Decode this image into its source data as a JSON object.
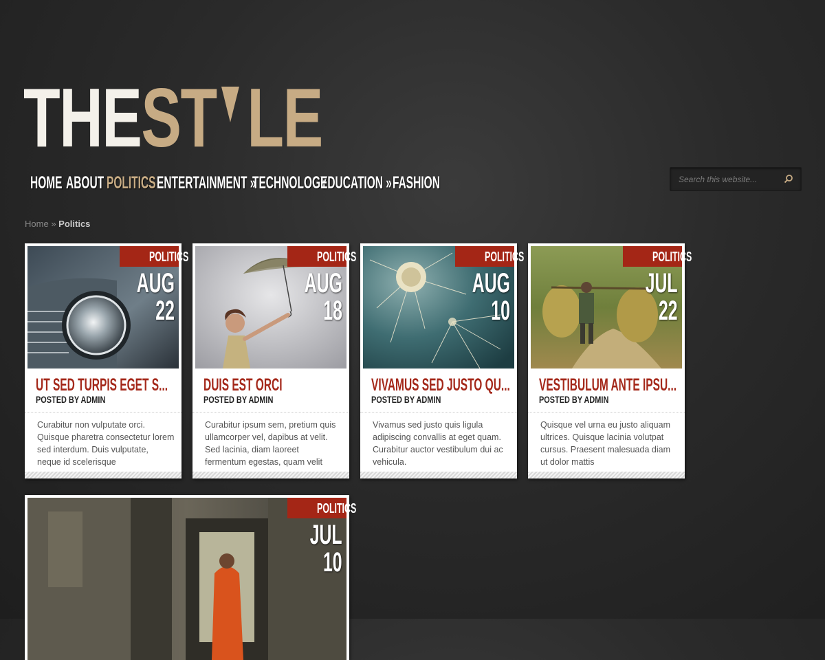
{
  "logo": {
    "part1": "THE",
    "part2": "ST",
    "part3": "LE"
  },
  "nav": {
    "items": [
      "HOME",
      "ABOUT",
      "POLITICS",
      "ENTERTAINMENT »",
      "TECHNOLOGY",
      "EDUCATION »",
      "FASHION"
    ],
    "active_index": 2
  },
  "search": {
    "placeholder": "Search this website..."
  },
  "breadcrumb": {
    "home": "Home",
    "sep": "»",
    "current": "Politics"
  },
  "posts": [
    {
      "category": "POLITICS",
      "month": "AUG",
      "day": "22",
      "title": "UT SED TURPIS EGET S...",
      "author": "POSTED BY ADMIN",
      "excerpt": "Curabitur non vulputate orci. Quisque pharetra consectetur lorem sed interdum. Duis vulputate, neque id scelerisque"
    },
    {
      "category": "POLITICS",
      "month": "AUG",
      "day": "18",
      "title": "DUIS EST ORCI",
      "author": "POSTED BY ADMIN",
      "excerpt": "Curabitur ipsum sem, pretium quis ullamcorper vel, dapibus at velit. Sed lacinia, diam laoreet fermentum egestas, quam velit"
    },
    {
      "category": "POLITICS",
      "month": "AUG",
      "day": "10",
      "title": "VIVAMUS SED JUSTO QU...",
      "author": "POSTED BY ADMIN",
      "excerpt": "Vivamus sed justo quis ligula adipiscing convallis at eget quam. Curabitur auctor vestibulum dui ac vehicula."
    },
    {
      "category": "POLITICS",
      "month": "JUL",
      "day": "22",
      "title": "VESTIBULUM ANTE IPSU...",
      "author": "POSTED BY ADMIN",
      "excerpt": "Quisque vel urna eu justo aliquam ultrices. Quisque lacinia volutpat cursus. Praesent malesuada diam ut dolor mattis"
    },
    {
      "category": "POLITICS",
      "month": "JUL",
      "day": "10"
    }
  ],
  "colors": {
    "accent_red": "#a42616",
    "logo_tan": "#c7ab84",
    "background": "#2a2a2a"
  }
}
